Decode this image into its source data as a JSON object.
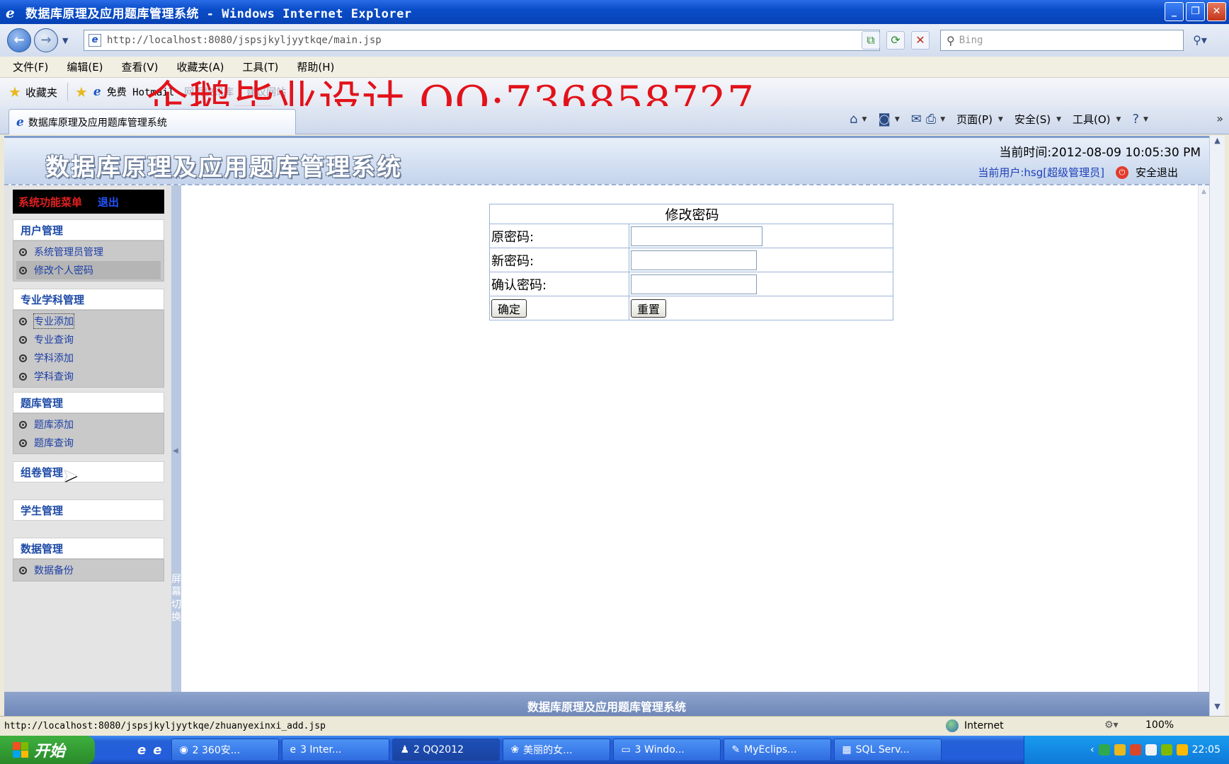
{
  "window": {
    "title": "数据库原理及应用题库管理系统 - Windows Internet Explorer",
    "buttons": {
      "minimize": "_",
      "maximize": "❐",
      "close": "✕"
    }
  },
  "browser": {
    "back_icon": "back-arrow-icon",
    "forward_icon": "forward-arrow-icon",
    "url": "http://localhost:8080/jspsjkyljyytkqe/main.jsp",
    "search_placeholder": "Bing",
    "menu": [
      "文件(F)",
      "编辑(E)",
      "查看(V)",
      "收藏夹(A)",
      "工具(T)",
      "帮助(H)"
    ],
    "favorites_label": "收藏夹",
    "fav_link": "免费 Hotmail",
    "fav_faded": [
      "网页快讯库",
      "建议网站"
    ],
    "watermark": "企鹅毕业设计 QQ:736858727",
    "tab_title": "数据库原理及应用题库管理系统",
    "command_bar": [
      "页面(P)",
      "安全(S)",
      "工具(O)"
    ],
    "status_url": "http://localhost:8080/jspsjkyljyytkqe/zhuanyexinxi_add.jsp",
    "zone": "Internet",
    "zoom": "100%"
  },
  "app": {
    "system_title": "数据库原理及应用题库管理系统",
    "current_time": "当前时间:2012-08-09 10:05:30 PM",
    "current_user": "当前用户:hsg[超级管理员]",
    "logout": "安全退出",
    "sidebar_title": "系统功能菜单",
    "sidebar_exit": "退出",
    "screen_switch": "屏幕切换",
    "footer": "数据库原理及应用题库管理系统",
    "groups": [
      {
        "title": "用户管理",
        "items": [
          "系统管理员管理",
          "修改个人密码"
        ]
      },
      {
        "title": "专业学科管理",
        "items": [
          "专业添加",
          "专业查询",
          "学科添加",
          "学科查询"
        ]
      },
      {
        "title": "题库管理",
        "items": [
          "题库添加",
          "题库查询"
        ]
      },
      {
        "title": "组卷管理",
        "items": []
      },
      {
        "title": "学生管理",
        "items": []
      },
      {
        "title": "数据管理",
        "items": [
          "数据备份"
        ]
      }
    ],
    "form": {
      "title": "修改密码",
      "old_label": "原密码:",
      "new_label": "新密码:",
      "confirm_label": "确认密码:",
      "submit": "确定",
      "reset": "重置"
    }
  },
  "taskbar": {
    "start": "开始",
    "tasks": [
      "2 360安...",
      "3 Inter...",
      "2 QQ2012",
      "美丽的女...",
      "3 Windo...",
      "MyEclips...",
      "SQL Serv..."
    ],
    "clock": "22:05"
  }
}
